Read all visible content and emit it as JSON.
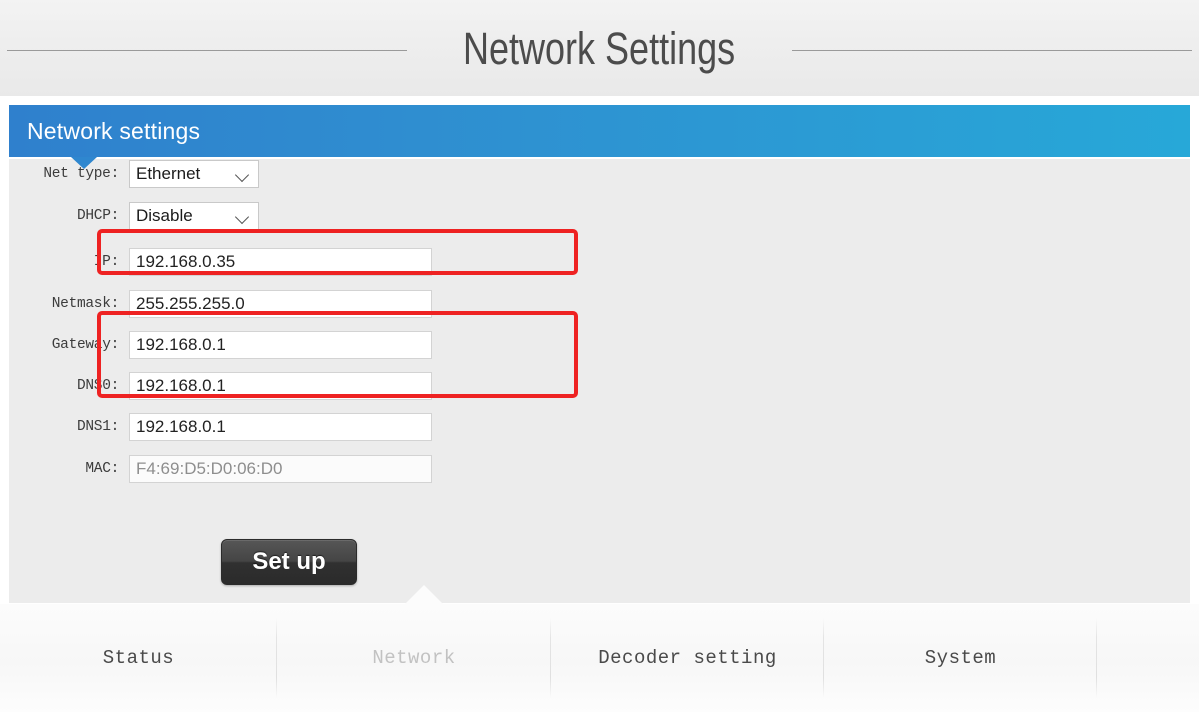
{
  "page": {
    "title": "Network Settings"
  },
  "panel": {
    "header_title": "Network settings"
  },
  "form": {
    "rows": [
      {
        "label": "Net type:",
        "type": "select",
        "value": "Ethernet"
      },
      {
        "label": "DHCP:",
        "type": "select",
        "value": "Disable"
      },
      {
        "label": "IP:",
        "type": "input",
        "value": "192.168.0.35"
      },
      {
        "label": "Netmask:",
        "type": "input",
        "value": "255.255.255.0"
      },
      {
        "label": "Gateway:",
        "type": "input",
        "value": "192.168.0.1"
      },
      {
        "label": "DNS0:",
        "type": "input",
        "value": "192.168.0.1"
      },
      {
        "label": "DNS1:",
        "type": "input",
        "value": "192.168.0.1"
      },
      {
        "label": "MAC:",
        "type": "input",
        "value": "F4:69:D5:D0:06:D0",
        "readonly": true
      }
    ],
    "submit_label": "Set up"
  },
  "annotations": {
    "highlight_color": "#ee2222",
    "boxes": [
      {
        "name": "ip-row-highlight",
        "targets": [
          "IP:"
        ]
      },
      {
        "name": "gateway-dns0-highlight",
        "targets": [
          "Gateway:",
          "DNS0:"
        ]
      }
    ]
  },
  "tabs": [
    {
      "label": "Status",
      "current": false
    },
    {
      "label": "Network",
      "current": true
    },
    {
      "label": "Decoder setting",
      "current": false
    },
    {
      "label": "System",
      "current": false
    }
  ],
  "colors": {
    "header_blue_left": "#2f80cd",
    "header_blue_right": "#27a8d8",
    "panel_bg": "#ececec",
    "page_bg": "#eeeeee",
    "button_dark": "#3a3a3a"
  }
}
